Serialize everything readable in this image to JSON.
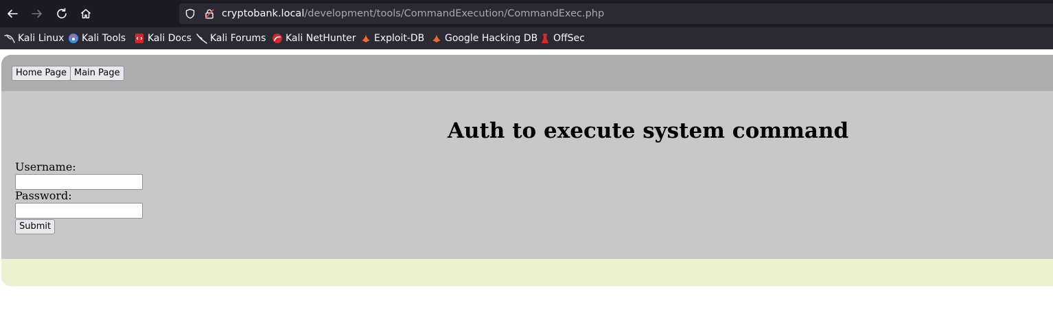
{
  "browser": {
    "url_host": "cryptobank.local",
    "url_path": "/development/tools/CommandExecution/CommandExec.php",
    "bookmarks": [
      {
        "label": "Kali Linux",
        "icon": "kali-dragon-icon"
      },
      {
        "label": "Kali Tools",
        "icon": "kali-tools-icon"
      },
      {
        "label": "Kali Docs",
        "icon": "kali-docs-icon"
      },
      {
        "label": "Kali Forums",
        "icon": "kali-forums-icon"
      },
      {
        "label": "Kali NetHunter",
        "icon": "kali-nethunter-icon"
      },
      {
        "label": "Exploit-DB",
        "icon": "exploit-db-icon"
      },
      {
        "label": "Google Hacking DB",
        "icon": "exploit-db-icon"
      },
      {
        "label": "OffSec",
        "icon": "offsec-icon"
      }
    ]
  },
  "page": {
    "nav_buttons": [
      "Home Page",
      "Main Page"
    ],
    "title": "Auth to execute system command",
    "username_label": "Username:",
    "password_label": "Password:",
    "username_value": "",
    "password_value": "",
    "submit_label": "Submit"
  },
  "colors": {
    "chrome_dark": "#1c1b22",
    "urlbar": "#2b2a33",
    "topnav": "#adadad",
    "content": "#c8c8c8",
    "footer": "#ecf1d2"
  }
}
